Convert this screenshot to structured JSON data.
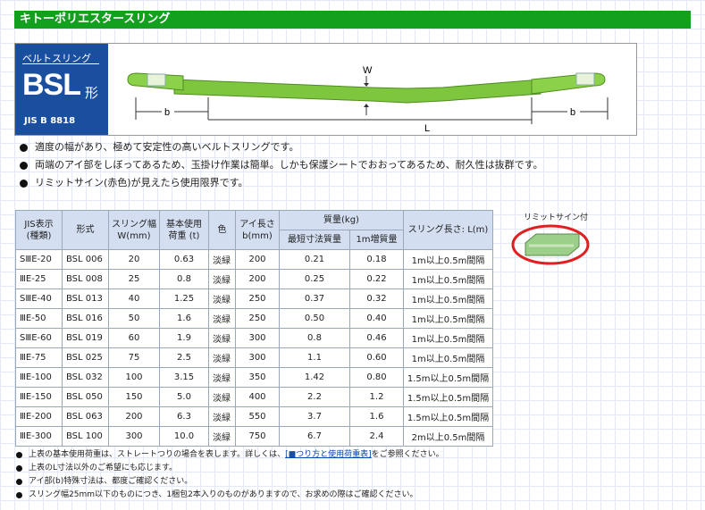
{
  "title": "キトーポリエスタースリング",
  "badge": {
    "subtitle": "ベルトスリング",
    "code": "BSL",
    "suffix": "形",
    "standard": "JIS B 8818"
  },
  "diagram": {
    "w": "W",
    "b_left": "b",
    "b_right": "b",
    "l": "L"
  },
  "features": [
    "適度の幅があり、極めて安定性の高いベルトスリングです。",
    "両端のアイ部をしぼってあるため、玉掛け作業は簡単。しかも保護シートでおおってあるため、耐久性は抜群です。",
    "リミットサイン(赤色)が見えたら使用限界です。"
  ],
  "table": {
    "headers": {
      "jis": [
        "JIS表示",
        "(種類)"
      ],
      "model": "形式",
      "width": [
        "スリング幅",
        "W(mm)"
      ],
      "load": [
        "基本使用",
        "荷重 (t)"
      ],
      "color": "色",
      "eye": [
        "アイ長さ",
        "b(mm)"
      ],
      "mass": "質量(kg)",
      "mass_min": "最短寸法質量",
      "mass_per": "1m増質量",
      "length": "スリング長さ: L(m)"
    },
    "rows": [
      [
        "SⅢE-20",
        "BSL 006",
        "20",
        "0.63",
        "淡緑",
        "200",
        "0.21",
        "0.18",
        "1m以上0.5m間隔"
      ],
      [
        "ⅢE-25",
        "BSL 008",
        "25",
        "0.8",
        "淡緑",
        "200",
        "0.25",
        "0.22",
        "1m以上0.5m間隔"
      ],
      [
        "SⅢE-40",
        "BSL 013",
        "40",
        "1.25",
        "淡緑",
        "250",
        "0.37",
        "0.32",
        "1m以上0.5m間隔"
      ],
      [
        "ⅢE-50",
        "BSL 016",
        "50",
        "1.6",
        "淡緑",
        "250",
        "0.50",
        "0.40",
        "1m以上0.5m間隔"
      ],
      [
        "SⅢE-60",
        "BSL 019",
        "60",
        "1.9",
        "淡緑",
        "300",
        "0.8",
        "0.46",
        "1m以上0.5m間隔"
      ],
      [
        "ⅢE-75",
        "BSL 025",
        "75",
        "2.5",
        "淡緑",
        "300",
        "1.1",
        "0.60",
        "1m以上0.5m間隔"
      ],
      [
        "ⅢE-100",
        "BSL 032",
        "100",
        "3.15",
        "淡緑",
        "350",
        "1.42",
        "0.80",
        "1.5m以上0.5m間隔"
      ],
      [
        "ⅢE-150",
        "BSL 050",
        "150",
        "5.0",
        "淡緑",
        "400",
        "2.2",
        "1.2",
        "1.5m以上0.5m間隔"
      ],
      [
        "ⅢE-200",
        "BSL 063",
        "200",
        "6.3",
        "淡緑",
        "550",
        "3.7",
        "1.6",
        "1.5m以上0.5m間隔"
      ],
      [
        "ⅢE-300",
        "BSL 100",
        "300",
        "10.0",
        "淡緑",
        "750",
        "6.7",
        "2.4",
        "2m以上0.5m間隔"
      ]
    ]
  },
  "limit_sign": {
    "label": "リミットサイン付"
  },
  "notes": {
    "n1_pre": "上表の基本使用荷重は、ストレートつりの場合を表します。詳しくは、",
    "n1_link_sq": "[■",
    "n1_link": "つり方と使用荷重表]",
    "n1_post": "をご参照ください。",
    "n2": "上表のL寸法以外のご希望にも応じます。",
    "n3": "アイ部(b)特殊寸法は、都度ご確認ください。",
    "n4": "スリング幅25mm以下のものにつき、1梱包2本入りのものがありますので、お求めの際はご確認ください。"
  },
  "colors": {
    "title_bar": "#14a01f",
    "badge": "#1a4fa0",
    "sling_green": "#7fc63f",
    "limit_ring": "#e02020"
  }
}
